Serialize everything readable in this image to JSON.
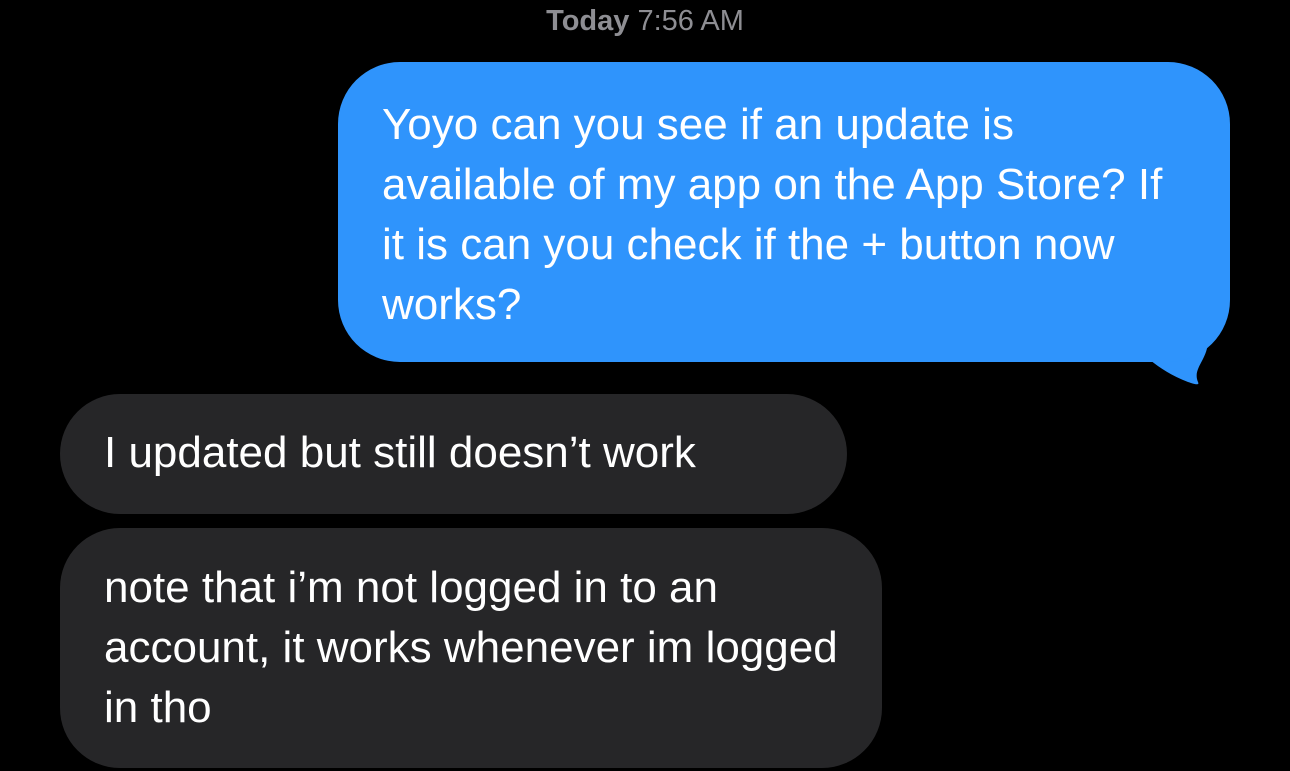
{
  "header": {
    "day": "Today",
    "time": "7:56 AM"
  },
  "messages": [
    {
      "direction": "sent",
      "text": "Yoyo can you see if an update is available of my app on the App Store? If it is can you check if the + button now works?"
    },
    {
      "direction": "received",
      "text": "I updated but still doesn’t work"
    },
    {
      "direction": "received",
      "text": "note that i’m not logged in to an account, it works whenever im logged in tho"
    }
  ],
  "colors": {
    "background": "#000000",
    "sent_bubble": "#2f94fc",
    "received_bubble": "#262628",
    "timestamp_text": "#8e8e93",
    "message_text": "#ffffff"
  }
}
